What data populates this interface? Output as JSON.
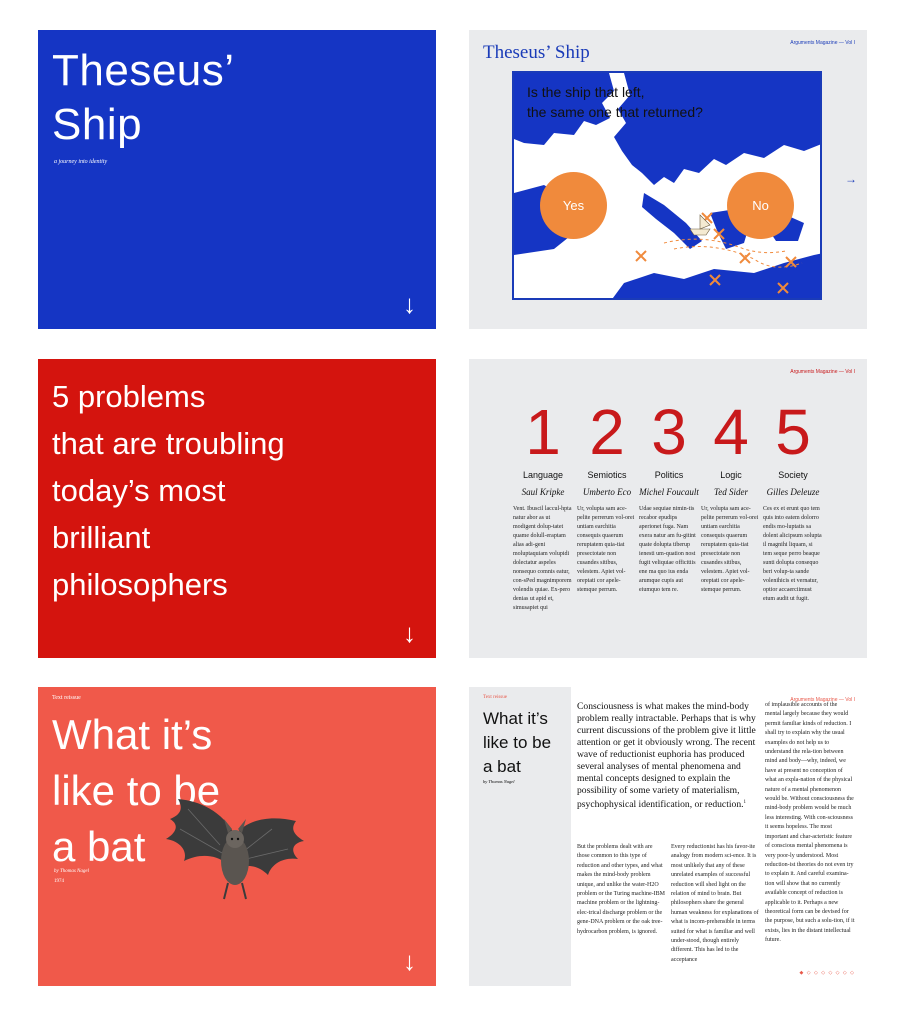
{
  "panel1": {
    "title_line1": "Theseus’",
    "title_line2": "Ship",
    "subtitle": "a journey into identity"
  },
  "panel2": {
    "title": "Theseus’ Ship",
    "magazine": "Arguments Magazine — Vol I",
    "question_line1": "Is the ship that left,",
    "question_line2": "the same one that returned?",
    "yes_label": "Yes",
    "no_label": "No",
    "next_arrow": "→"
  },
  "panel3": {
    "title_lines": [
      "5 problems",
      "that are troubling",
      "today’s most",
      "brilliant",
      "philosophers"
    ]
  },
  "panel4": {
    "magazine": "Arguments Magazine — Vol I",
    "problems": [
      {
        "number": "1",
        "topic": "Language",
        "author": "Saul Kripke",
        "body": "Vent. Ibuscil laccul-hpta natur abor as ut modigent dolup-tatet quame dolull-eraptam alias adi-geni moluptaquiam volupidi dolectatur aspeles nonsequo comnis eatur, con-sPed magnimporem volendis quiae. Ex-pero denias ut apid et, simusapiet qui"
      },
      {
        "number": "2",
        "topic": "Semiotics",
        "author": "Umberto Eco",
        "body": "Ur, volupta sam ace-pelite perrerum vol-orei untiam earchitia consequis quaerum reruptatem quia-tiat presectotate non cusandes sitibus, velestem. Apiet vol-oreptati cor apele-stemque perrum."
      },
      {
        "number": "3",
        "topic": "Politics",
        "author": "Michel Foucault",
        "body": "Udae sequiae nimin-tis recabor epudips aperionet fuga. Nam exera natur am fu-gitint quate dolupta tiberup ienesti um-quation nost fugit veliquiae officitiis ene ma quo ius enda arumque cupis aut eiumquo tem re."
      },
      {
        "number": "4",
        "topic": "Logic",
        "author": "Ted Sider",
        "body": "Ur, volupta sam ace-pelite perrerum vol-orei untiam earchitia consequis quaerum reruptatem quia-tiat presectotate non cusandes sitibus, velestem. Apiet vol-oreptati cor apele-stemque perrum."
      },
      {
        "number": "5",
        "topic": "Society",
        "author": "Gilles Deleuze",
        "body": "Ces ex et erunt quo tem quis into eatem dolorro endis mo-luptatis sa dolent alicipsum solupta il magnihi liquam, si tem seque perro beaque sunti dolupta consequo beri volup-ta sande volenihicis et vernatur, optior accaerciimust etum audit ut fugit."
      }
    ]
  },
  "panel5": {
    "label": "Text reissue",
    "title_lines": [
      "What it’s",
      "like to be",
      "a bat"
    ],
    "by": "by Thomas Nagel",
    "year": "1974"
  },
  "panel6": {
    "label": "Text reissue",
    "magazine": "Arguments Magazine — Vol I",
    "title_lines": [
      "What it’s",
      "like to be",
      "a bat"
    ],
    "by": "by Thomas Nagel",
    "lead": "Consciousness is what makes the mind-body problem really intractable. Perhaps that is why current discussions of the problem give it little attention or get it obviously wrong. The recent wave of reductionist euphoria has produced several analyses of mental phenomena and mental concepts designed to explain the possibility of some variety of materialism, psychophysical identification, or reduction.",
    "lead_note": "1",
    "col1": "But the problems dealt with are those common to this type of reduction and other types, and what makes the mind-body problem unique, and unlike the water-H2O problem or the Turing machine-IBM machine problem or the lightning-elec-trical discharge problem or the gene-DNA problem or the oak tree-hydrocarbon problem, is ignored.",
    "col2": "Every reductionist has his favor-ite analogy from modern sci-ence. It is most unlikely that any of these unrelated examples of successful reduction will shed light on the relation of mind to brain. But philosophers share the general human weakness for explanations of what is incom-prehensible in terms suited for what is familiar and well under-stood, though entirely different. This has led to the acceptance",
    "col3": "of implausible accounts of the mental largely because they would permit familiar kinds of reduction. I shall try to explain why the usual examples do not help us to understand the rela-tion between mind and body—why, indeed, we have at present no conception of what an expla-nation of the physical nature of a mental phenomenon would be. Without consciousness the mind-body problem would be much less interesting. With con-sciousness it seems hopeless. The most important and char-acteristic feature of conscious mental phenomena is very poor-ly understood. Most reduction-ist theories do not even try to explain it. And careful examina-tion will show that no currently available concept of reduction is applicable to it. Perhaps a new theoretical form can be devised for the purpose, but such a solu-tion, if it exists, lies in the distant intellectual future.",
    "dots": "◆ ◇ ◇ ◇ ◇ ◇ ◇ ◇"
  },
  "arrow_down": "↓",
  "colors": {
    "blue": "#1535c4",
    "red": "#d4140e",
    "coral": "#f0594a",
    "orange": "#f08a3c",
    "grey": "#eaebed"
  }
}
